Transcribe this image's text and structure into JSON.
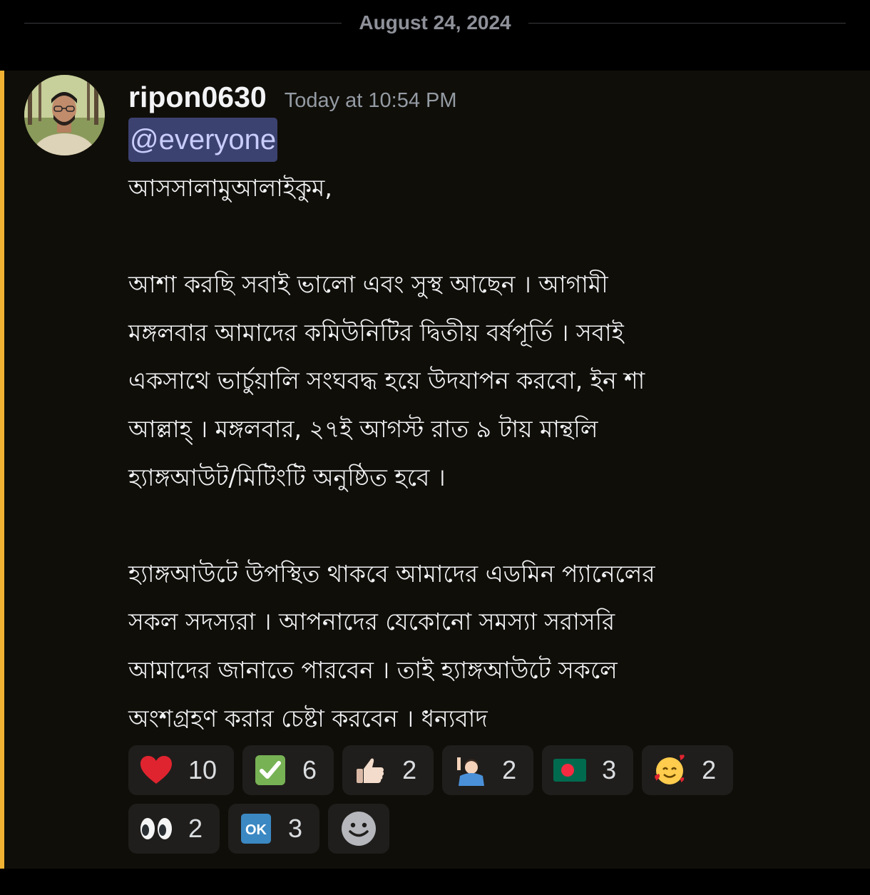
{
  "date_divider": "August 24, 2024",
  "message": {
    "author": "ripon0630",
    "timestamp": "Today at 10:54 PM",
    "mention": "@everyone",
    "paragraphs": [
      [
        "আসসালামুআলাইকুম,"
      ],
      [
        "আশা করছি সবাই ভালো এবং সুস্থ আছেন । আগামী",
        "মঙ্গলবার আমাদের কমিউনিটির দ্বিতীয় বর্ষপূর্তি । সবাই",
        "একসাথে ভার্চুয়ালি সংঘবদ্ধ হয়ে উদযাপন করবো, ইন শা",
        "আল্লাহ্‌ । মঙ্গলবার, ২৭ই  আগস্ট  রাত ৯ টায় মান্থলি",
        "হ্যাঙ্গআউট/মিটিংটি অনুষ্ঠিত হবে ।"
      ],
      [
        "হ্যাঙ্গআউটে উপস্থিত থাকবে আমাদের এডমিন প্যানেলের",
        "সকল সদস্যরা ।  আপনাদের যেকোনো সমস্যা সরাসরি",
        "আমাদের জানাতে পারবেন । তাই হ্যাঙ্গআউটে সকলে",
        "অংশগ্রহণ করার চেষ্টা করবেন ।  ধন্যবাদ"
      ]
    ]
  },
  "reactions": [
    {
      "emoji": "heart-emoji",
      "count": "10"
    },
    {
      "emoji": "check-mark-emoji",
      "count": "6"
    },
    {
      "emoji": "thumbs-up-emoji",
      "count": "2"
    },
    {
      "emoji": "person-raising-hand-emoji",
      "count": "2"
    },
    {
      "emoji": "bangladesh-flag-emoji",
      "count": "3"
    },
    {
      "emoji": "smiling-face-with-hearts-emoji",
      "count": "2"
    },
    {
      "emoji": "eyes-emoji",
      "count": "2"
    },
    {
      "emoji": "ok-button-emoji",
      "count": "3"
    }
  ],
  "add_reaction_icon": "add-reaction-smiley-icon",
  "colors": {
    "highlight_bar": "#f0b232",
    "message_bg": "#100e09",
    "mention_bg": "#3c4270",
    "mention_text": "#c9cdfb",
    "reaction_bg": "#201e1c"
  }
}
